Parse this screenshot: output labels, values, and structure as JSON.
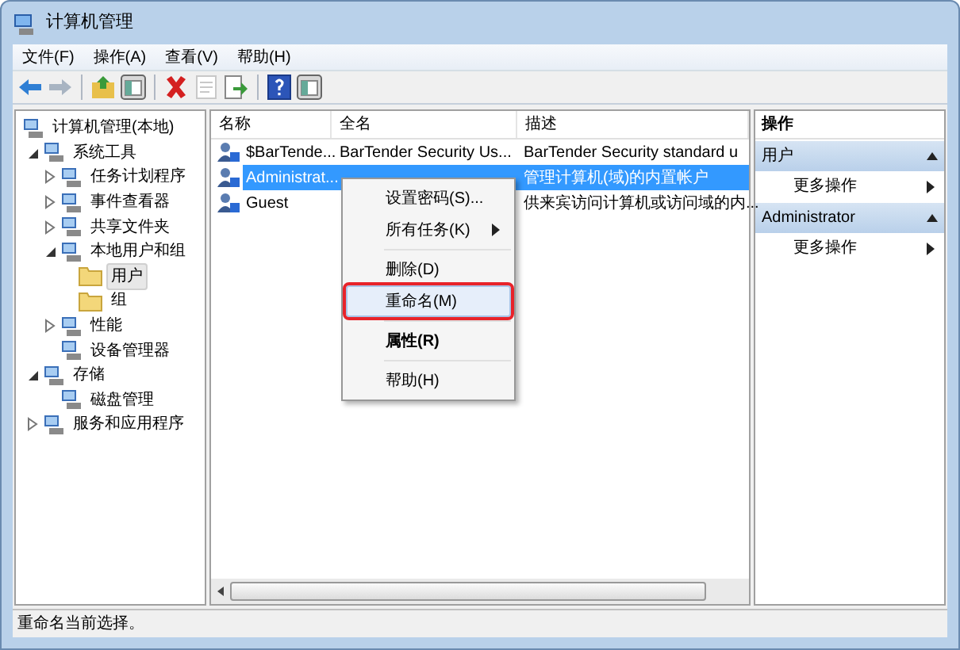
{
  "window": {
    "title": "计算机管理"
  },
  "menu": [
    "文件(F)",
    "操作(A)",
    "查看(V)",
    "帮助(H)"
  ],
  "toolbar": [
    {
      "buttons": [
        {
          "kind": "back",
          "disabled": false
        },
        {
          "kind": "forward",
          "disabled": true
        }
      ]
    },
    {
      "buttons": [
        {
          "kind": "up",
          "disabled": false
        },
        {
          "kind": "pane",
          "disabled": false
        }
      ]
    },
    {
      "buttons": [
        {
          "kind": "delete",
          "disabled": false
        },
        {
          "kind": "properties",
          "disabled": true
        },
        {
          "kind": "export",
          "disabled": false
        }
      ]
    },
    {
      "buttons": [
        {
          "kind": "help",
          "disabled": false
        },
        {
          "kind": "pane",
          "disabled": false
        }
      ]
    }
  ],
  "tree": [
    {
      "label": "计算机管理(本地)",
      "selected": false,
      "children": [
        {
          "label": "系统工具",
          "expanded": true,
          "selected": false,
          "children": [
            {
              "label": "任务计划程序",
              "expanded": false,
              "selected": false
            },
            {
              "label": "事件查看器",
              "expanded": false,
              "selected": false
            },
            {
              "label": "共享文件夹",
              "expanded": false,
              "selected": false
            },
            {
              "label": "本地用户和组",
              "expanded": true,
              "selected": false,
              "children": [
                {
                  "label": "用户",
                  "selected": true
                },
                {
                  "label": "组",
                  "selected": false
                }
              ]
            },
            {
              "label": "性能",
              "expanded": false,
              "selected": false
            },
            {
              "label": "设备管理器",
              "selected": false
            }
          ]
        },
        {
          "label": "存储",
          "expanded": true,
          "selected": false,
          "children": [
            {
              "label": "磁盘管理",
              "selected": false
            }
          ]
        },
        {
          "label": "服务和应用程序",
          "expanded": false,
          "selected": false
        }
      ]
    }
  ],
  "table": {
    "columns": [
      "名称",
      "全名",
      "描述"
    ],
    "rows": [
      {
        "name": "$BarTende...",
        "full_name": "BarTender Security Us...",
        "description": "BarTender Security standard u",
        "selected": false
      },
      {
        "name": "Administrat...",
        "description": "管理计算机(域)的内置帐户",
        "selected": true
      },
      {
        "name": "Guest",
        "description": "供来宾访问计算机或访问域的内...",
        "selected": false
      }
    ]
  },
  "context_menu": [
    {
      "kind": "item",
      "label": "设置密码(S)...",
      "submenu": false,
      "selected": false,
      "bold": false,
      "outlined": false
    },
    {
      "kind": "item",
      "label": "所有任务(K)",
      "submenu": true,
      "selected": false,
      "bold": false,
      "outlined": false
    },
    {
      "kind": "separator"
    },
    {
      "kind": "item",
      "label": "删除(D)",
      "submenu": false,
      "selected": false,
      "bold": false,
      "outlined": false
    },
    {
      "kind": "item",
      "label": "重命名(M)",
      "submenu": false,
      "selected": true,
      "bold": false,
      "outlined": true
    },
    {
      "kind": "separator"
    },
    {
      "kind": "item",
      "label": "属性(R)",
      "submenu": false,
      "selected": false,
      "bold": true,
      "outlined": false
    },
    {
      "kind": "separator"
    },
    {
      "kind": "item",
      "label": "帮助(H)",
      "submenu": false,
      "selected": false,
      "bold": false,
      "outlined": false
    }
  ],
  "actions": {
    "title": "操作",
    "sections": [
      {
        "title": "用户",
        "items": [
          "更多操作"
        ]
      },
      {
        "title": "Administrator",
        "items": [
          "更多操作"
        ]
      }
    ]
  },
  "status_bar": "重命名当前选择。"
}
